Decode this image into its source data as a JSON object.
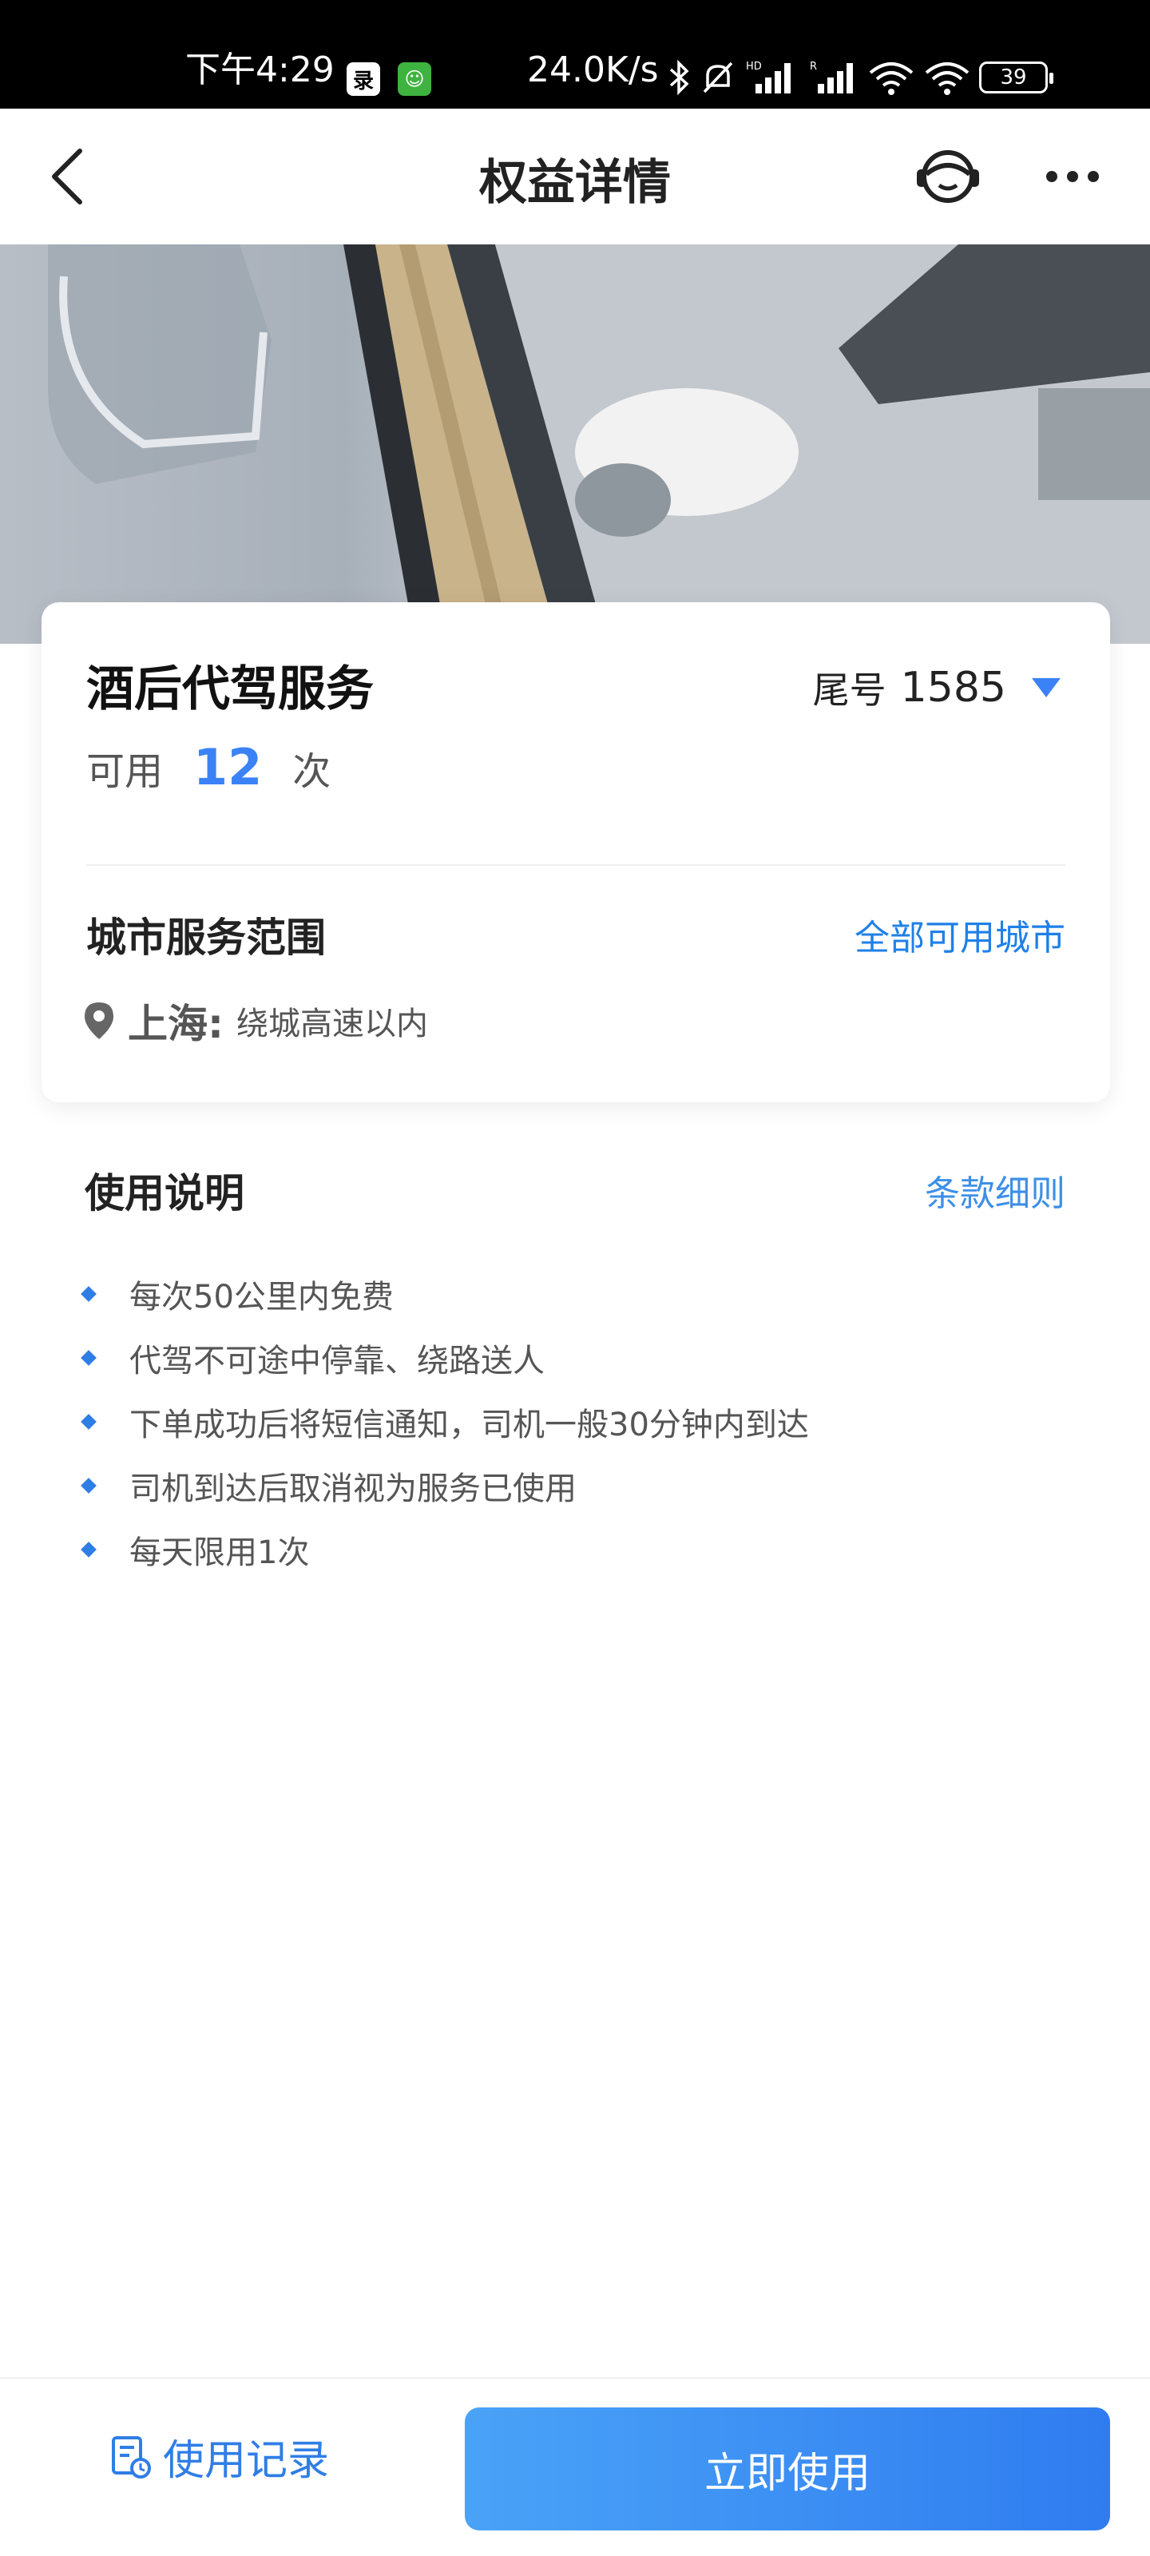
{
  "status_bar": {
    "time": "下午4:29",
    "app_icon_1": "录",
    "app_icon_2": "☺",
    "network_speed": "24.0K/s",
    "battery": "39",
    "icons": [
      "bluetooth-icon",
      "mute-bell-icon",
      "hd-signal-icon",
      "roaming-signal-icon",
      "wifi-icon",
      "wifi-icon"
    ]
  },
  "nav": {
    "title": "权益详情"
  },
  "hero": {
    "image_name": "chauffeur-car-door-photo"
  },
  "card": {
    "title": "酒后代驾服务",
    "tail_label": "尾号",
    "tail_number": "1585",
    "usage_label": "可用",
    "usage_count": "12",
    "usage_unit": "次",
    "scope_title": "城市服务范围",
    "scope_link": "全部可用城市",
    "city": "上海:",
    "city_desc": "绕城高速以内"
  },
  "instructions": {
    "title": "使用说明",
    "link": "条款细则",
    "items": [
      "每次50公里内免费",
      "代驾不可途中停靠、绕路送人",
      "下单成功后将短信通知，司机一般30分钟内到达",
      "司机到达后取消视为服务已使用",
      "每天限用1次"
    ]
  },
  "bottom": {
    "records_label": "使用记录",
    "use_button": "立即使用"
  },
  "colors": {
    "accent": "#3b82f6",
    "link": "#1f80e8",
    "button_start": "#4aa3f7",
    "button_end": "#2f7cf0"
  }
}
